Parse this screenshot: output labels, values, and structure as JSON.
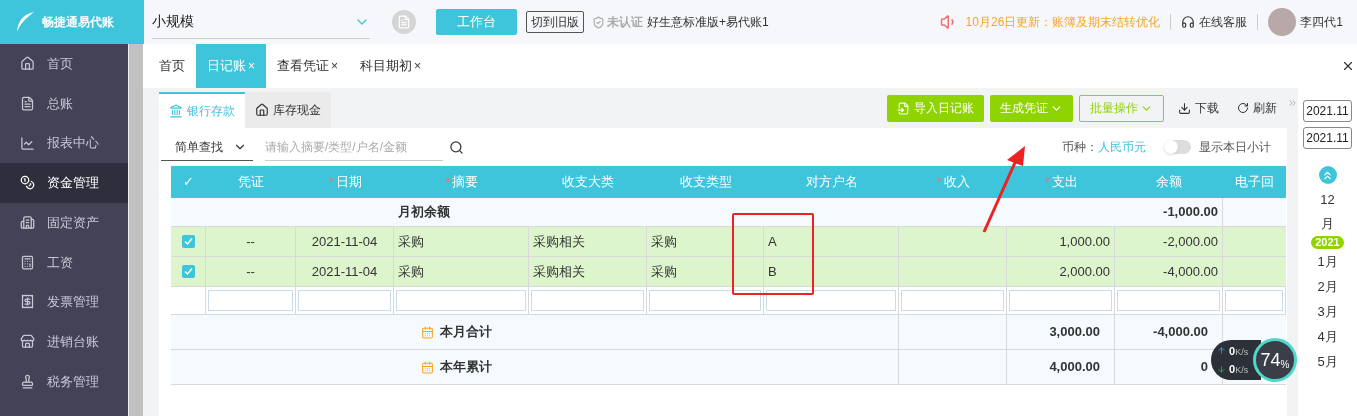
{
  "header": {
    "logo": "畅捷通易代账",
    "company_select": "小规模",
    "workbench_button": "工作台",
    "old_version_button": "切到旧版",
    "auth_status": "未认证",
    "product": "好生意标准版+易代账1",
    "notice": "10月26日更新：账簿及期末结转优化",
    "support": "在线客服",
    "user": "李四代1"
  },
  "sidebar": {
    "items": [
      {
        "label": "首页",
        "selected": false
      },
      {
        "label": "总账",
        "selected": false
      },
      {
        "label": "报表中心",
        "selected": false
      },
      {
        "label": "资金管理",
        "selected": true
      },
      {
        "label": "固定资产",
        "selected": false
      },
      {
        "label": "工资",
        "selected": false
      },
      {
        "label": "发票管理",
        "selected": false
      },
      {
        "label": "进销台账",
        "selected": false
      },
      {
        "label": "税务管理",
        "selected": false
      }
    ]
  },
  "tabs": [
    {
      "label": "首页",
      "selected": false
    },
    {
      "label": "日记账",
      "close": "×",
      "selected": true
    },
    {
      "label": "查看凭证",
      "close": "×",
      "selected": false
    },
    {
      "label": "科目期初",
      "close": "×",
      "selected": false
    }
  ],
  "account_tabs": [
    {
      "label": "银行存款",
      "selected": true
    },
    {
      "label": "库存现金",
      "selected": false
    }
  ],
  "toolbar": {
    "import": "导入日记账",
    "generate": "生成凭证",
    "batch": "批量操作",
    "download": "下载",
    "refresh": "刷新"
  },
  "filter": {
    "mode": "简单查找",
    "placeholder": "请输入摘要/类型/户名/金额",
    "currency_label": "币种：",
    "currency": "人民币元",
    "daily_subtotal": {
      "label": "显示本日小计",
      "on": false
    }
  },
  "table": {
    "columns": [
      {
        "label": "✓",
        "required": false
      },
      {
        "label": "凭证",
        "required": false
      },
      {
        "label": "日期",
        "required": true
      },
      {
        "label": "摘要",
        "required": true
      },
      {
        "label": "收支大类",
        "required": false
      },
      {
        "label": "收支类型",
        "required": false
      },
      {
        "label": "对方户名",
        "required": false
      },
      {
        "label": "收入",
        "required": true
      },
      {
        "label": "支出",
        "required": true
      },
      {
        "label": "余额",
        "required": false
      },
      {
        "label": "电子回",
        "required": false
      }
    ],
    "required_mark": "*",
    "rows": [
      {
        "kind": "opening",
        "label": "月初余额",
        "balance": "-1,000.00"
      },
      {
        "kind": "entry",
        "checked": true,
        "voucher": "--",
        "date": "2021-11-04",
        "summary": "采购",
        "category": "采购相关",
        "type": "采购",
        "party": "A",
        "income": "",
        "expense": "1,000.00",
        "balance": "-2,000.00"
      },
      {
        "kind": "entry",
        "checked": true,
        "voucher": "--",
        "date": "2021-11-04",
        "summary": "采购",
        "category": "采购相关",
        "type": "采购",
        "party": "B",
        "income": "",
        "expense": "2,000.00",
        "balance": "-4,000.00"
      },
      {
        "kind": "input"
      },
      {
        "kind": "total",
        "label": "本月合计",
        "expense": "3,000.00",
        "balance": "-4,000.00"
      },
      {
        "kind": "total",
        "label": "本年累计",
        "expense": "4,000.00",
        "balance": "0"
      }
    ]
  },
  "timeline": {
    "dates": [
      "2021.11",
      "2021.11"
    ],
    "months": [
      "12月",
      "1月",
      "2月",
      "3月",
      "4月",
      "5月"
    ],
    "year_badge": "2021"
  },
  "speed_widget": {
    "up": "0",
    "up_unit": "K/s",
    "down": "0",
    "down_unit": "K/s",
    "percent": "74",
    "percent_sign": "%"
  }
}
